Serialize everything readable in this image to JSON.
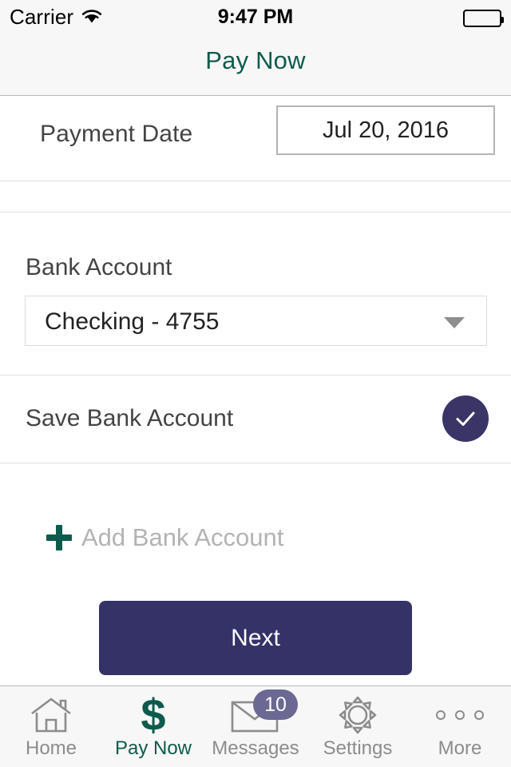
{
  "status_bar": {
    "carrier": "Carrier",
    "wifi_icon": "wifi-icon",
    "time": "9:47 PM",
    "battery_icon": "battery-full-icon"
  },
  "nav": {
    "title": "Pay Now",
    "title_color": "#0d5b4c"
  },
  "form": {
    "payment_date": {
      "label": "Payment Date",
      "value": "Jul 20, 2016"
    },
    "bank_account": {
      "label": "Bank Account",
      "selected": "Checking - 4755",
      "caret_icon": "chevron-down-icon"
    },
    "save_bank_account": {
      "label": "Save Bank Account",
      "checked": true,
      "check_icon": "check-icon",
      "check_color": "#3a3566"
    },
    "add_bank_account": {
      "label": "Add Bank Account",
      "plus_icon": "plus-icon",
      "plus_color": "#0d5b4c",
      "label_color": "#b3b3b3"
    }
  },
  "primary_action": {
    "label": "Next",
    "color": "#353268"
  },
  "tabbar": {
    "items": [
      {
        "label": "Home",
        "icon": "home-icon",
        "active": false
      },
      {
        "label": "Pay Now",
        "icon": "dollar-icon",
        "active": true,
        "glyph": "$"
      },
      {
        "label": "Messages",
        "icon": "envelope-icon",
        "active": false,
        "badge": "10"
      },
      {
        "label": "Settings",
        "icon": "gear-icon",
        "active": false
      },
      {
        "label": "More",
        "icon": "ellipsis-icon",
        "active": false
      }
    ]
  }
}
